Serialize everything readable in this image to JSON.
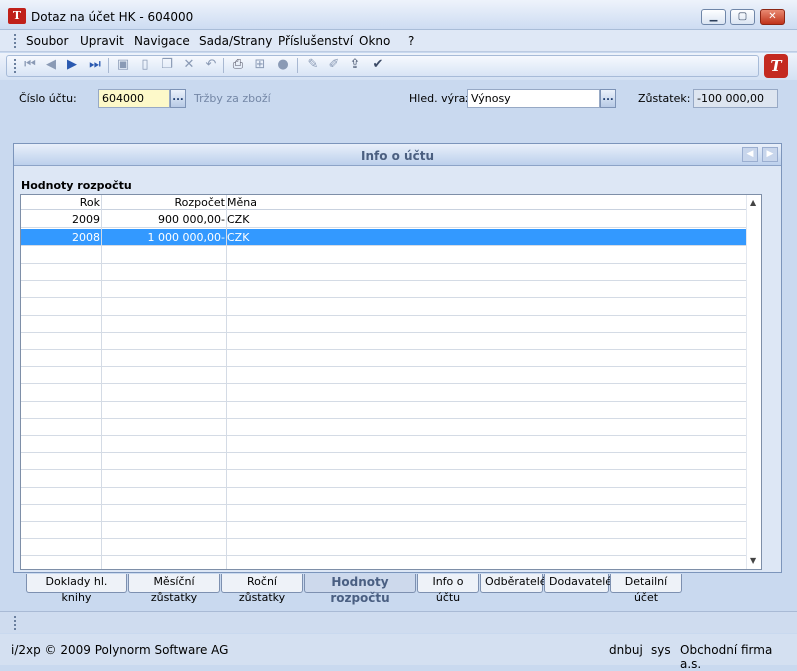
{
  "window": {
    "title": "Dotaz na účet HK - 604000",
    "logo_text": "T"
  },
  "menu": [
    "Soubor",
    "Upravit",
    "Navigace",
    "Sada/Strany",
    "Příslušenství",
    "Okno",
    "?"
  ],
  "toolbar": {
    "icons": [
      "first-record-icon",
      "previous-record-icon",
      "next-record-icon",
      "last-record-icon",
      "save-icon",
      "new-document-icon",
      "copy-icon",
      "delete-icon",
      "undo-icon",
      "print-icon",
      "tree-icon",
      "disc-icon",
      "edit-pencil-icon",
      "highlight-pencil-icon",
      "export-icon",
      "filter-check-icon"
    ]
  },
  "form": {
    "account_label": "Číslo účtu:",
    "account_value": "604000",
    "account_desc": "Tržby za zboží",
    "search_label": "Hled. výraz:",
    "search_value": "Výnosy",
    "balance_label": "Zůstatek:",
    "balance_value": "-100 000,00",
    "dots": "..."
  },
  "panel": {
    "title": "Info o účtu",
    "section_title": "Hodnoty rozpočtu",
    "columns": [
      "Rok",
      "Rozpočet",
      "Měna"
    ],
    "rows": [
      {
        "year": "2009",
        "budget": "900 000,00-",
        "currency": "CZK"
      },
      {
        "year": "2008",
        "budget": "1 000 000,00-",
        "currency": "CZK"
      }
    ],
    "selected_row": 1
  },
  "tabs": [
    "Doklady hl. knihy",
    "Měsíční zůstatky",
    "Roční zůstatky",
    "Hodnoty rozpočtu",
    "Info o účtu",
    "Odběratelé",
    "Dodavatelé",
    "Detailní účet"
  ],
  "active_tab": 3,
  "footer": {
    "copyright": "i/2xp © 2009 Polynorm Software AG",
    "user": "dnbuj",
    "system": "sys",
    "company": "Obchodní firma a.s."
  },
  "colors": {
    "selection": "#3399ff",
    "account_field_bg": "#fdf9c9",
    "brand_red": "#c42a20"
  }
}
